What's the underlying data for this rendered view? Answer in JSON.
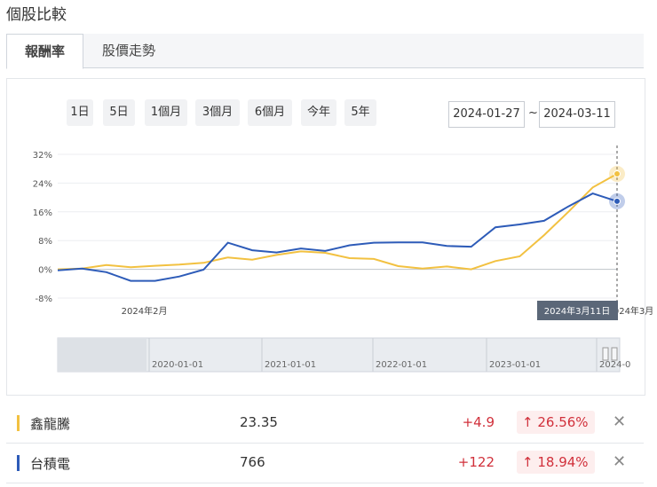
{
  "page": {
    "title": "個股比較"
  },
  "tabs": {
    "return": "報酬率",
    "trend": "股價走勢"
  },
  "ranges": [
    "1日",
    "5日",
    "1個月",
    "3個月",
    "6個月",
    "今年",
    "5年"
  ],
  "date_from": "2024-01-27",
  "date_sep": "~",
  "date_to": "2024-03-11",
  "colors": {
    "xlt": "#f2c141",
    "tsmc": "#2d5bb8",
    "up": "#d1303b"
  },
  "chart_data": {
    "type": "line",
    "yticks": [
      "32%",
      "24%",
      "16%",
      "8%",
      "0%",
      "-8%"
    ],
    "ylim": [
      -8,
      32
    ],
    "xticks": [
      {
        "label": "2024年2月",
        "i": 4
      },
      {
        "label": "2024年3月",
        "i": 24
      }
    ],
    "tooltip": "2024年3月11日",
    "series": [
      {
        "name": "鑫龍騰",
        "color": "#f2c141",
        "values": [
          0,
          0.2,
          1.2,
          0.6,
          1,
          1.3,
          1.8,
          3.3,
          2.7,
          4,
          5,
          4.6,
          3.1,
          2.9,
          0.9,
          0.2,
          0.8,
          0,
          2.3,
          3.6,
          9.5,
          16,
          22.8,
          26.56
        ]
      },
      {
        "name": "台積電",
        "color": "#2d5bb8",
        "values": [
          -0.3,
          0.2,
          -0.8,
          -3.2,
          -3.2,
          -2,
          -0.1,
          7.4,
          5.3,
          4.7,
          5.8,
          5.1,
          6.7,
          7.4,
          7.5,
          7.5,
          6.5,
          6.3,
          11.7,
          12.5,
          13.5,
          17.5,
          21.1,
          18.94
        ]
      }
    ],
    "navigator_ticks": [
      "2020-01-01",
      "2021-01-01",
      "2022-01-01",
      "2023-01-01",
      "2024-0"
    ]
  },
  "stocks": [
    {
      "name": "鑫龍騰",
      "price": "23.35",
      "change": "+4.9",
      "pct": "26.56%",
      "arrow": "↑",
      "color": "#f2c141"
    },
    {
      "name": "台積電",
      "price": "766",
      "change": "+122",
      "pct": "18.94%",
      "arrow": "↑",
      "color": "#2d5bb8"
    }
  ],
  "close_glyph": "✕"
}
